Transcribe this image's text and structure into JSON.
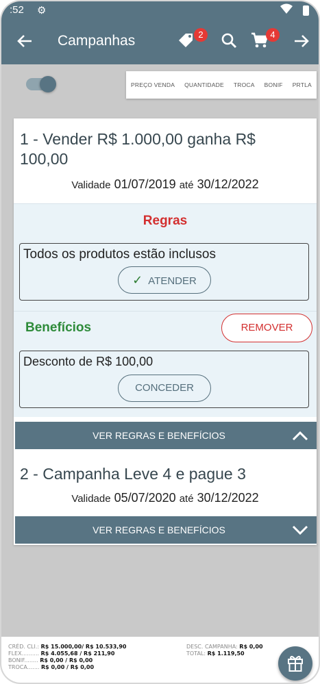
{
  "status": {
    "time": ":52"
  },
  "appbar": {
    "title": "Campanhas",
    "tag_badge": "2",
    "cart_badge": "4"
  },
  "tabs": [
    "PREÇO VENDA",
    "QUANTIDADE",
    "TROCA",
    "BONIF",
    "PRTLA"
  ],
  "campaign1": {
    "title": "1 - Vender R$ 1.000,00 ganha R$ 100,00",
    "validity_label": "Validade",
    "start": "01/07/2019",
    "until": "até",
    "end": "30/12/2022",
    "rules_heading": "Regras",
    "rule_text": "Todos os produtos estão inclusos",
    "attend_label": "ATENDER",
    "benefits_heading": "Benefícios",
    "remove_label": "REMOVER",
    "benefit_text": "Desconto de R$ 100,00",
    "grant_label": "CONCEDER",
    "toggle_label": "VER REGRAS E BENEFÍCIOS"
  },
  "campaign2": {
    "title": "2 - Campanha Leve 4 e pague 3",
    "validity_label": "Validade",
    "start": "05/07/2020",
    "until": "até",
    "end": "30/12/2022",
    "toggle_label": "VER REGRAS E BENEFÍCIOS"
  },
  "footer": {
    "cred_label": "CRÉD. CLI.:",
    "cred_value": "R$ 15.000,00/ R$ 10.533,90",
    "flex_label": "FLEX..........",
    "flex_value": "R$ 4.055,68 / R$ 211,90",
    "bonif_label": "BONIF........",
    "bonif_value": "R$ 0,00 / R$ 0,00",
    "troca_label": "TROCA.......",
    "troca_value": "R$ 0,00 / R$ 0,00",
    "desc_label": "DESC. CAMPANHA:",
    "desc_value": "R$ 0,00",
    "total_label": "TOTAL:",
    "total_value": "R$ 1.119,50"
  }
}
